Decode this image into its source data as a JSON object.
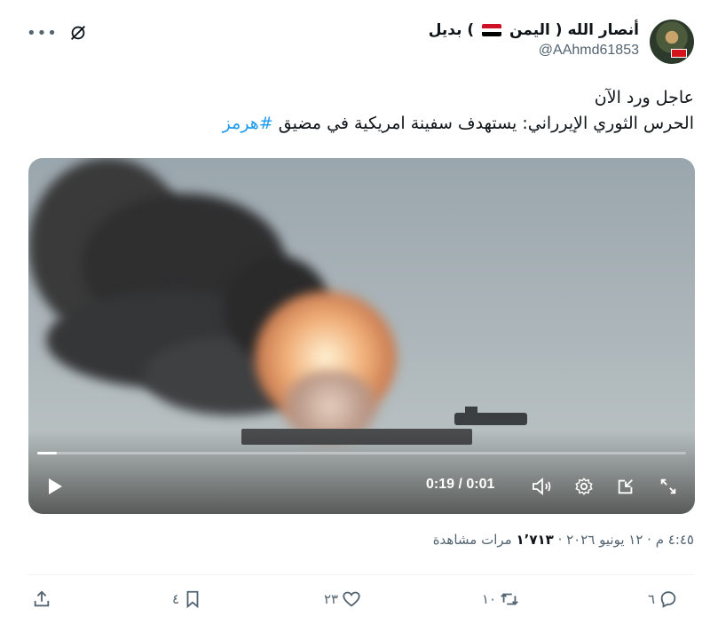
{
  "tweet": {
    "author": {
      "display_name": "أنصار الله ( اليمن",
      "display_name_suffix": ") بديل",
      "handle": "@AAhmd61853",
      "flag_colors": [
        "#ce1126",
        "#ffffff",
        "#000000"
      ]
    },
    "text_line1": "عاجل ورد الآن",
    "text_line2": "الحرس الثوري الإيرراني: يستهدف سفينة امريكية في مضيق",
    "hashtag": "#هرمز",
    "accent_color": "#1d9bf0"
  },
  "video": {
    "time_display": "0:19 / 0:01",
    "progress": 0.03,
    "icons": [
      "play-icon",
      "volume-icon",
      "settings-icon",
      "popout-icon",
      "fullscreen-icon"
    ]
  },
  "meta": {
    "timestamp": "٤:٤٥ م · ١٢ يونيو ٢٠٢٦ ·",
    "views_count": "١٬٧١٣",
    "views_label": "مرات مشاهدة"
  },
  "actions": {
    "replies": "٦",
    "reposts": "١٠",
    "likes": "٢٣",
    "bookmarks": "٤"
  },
  "header_icons": [
    "more-icon",
    "grok-icon"
  ]
}
